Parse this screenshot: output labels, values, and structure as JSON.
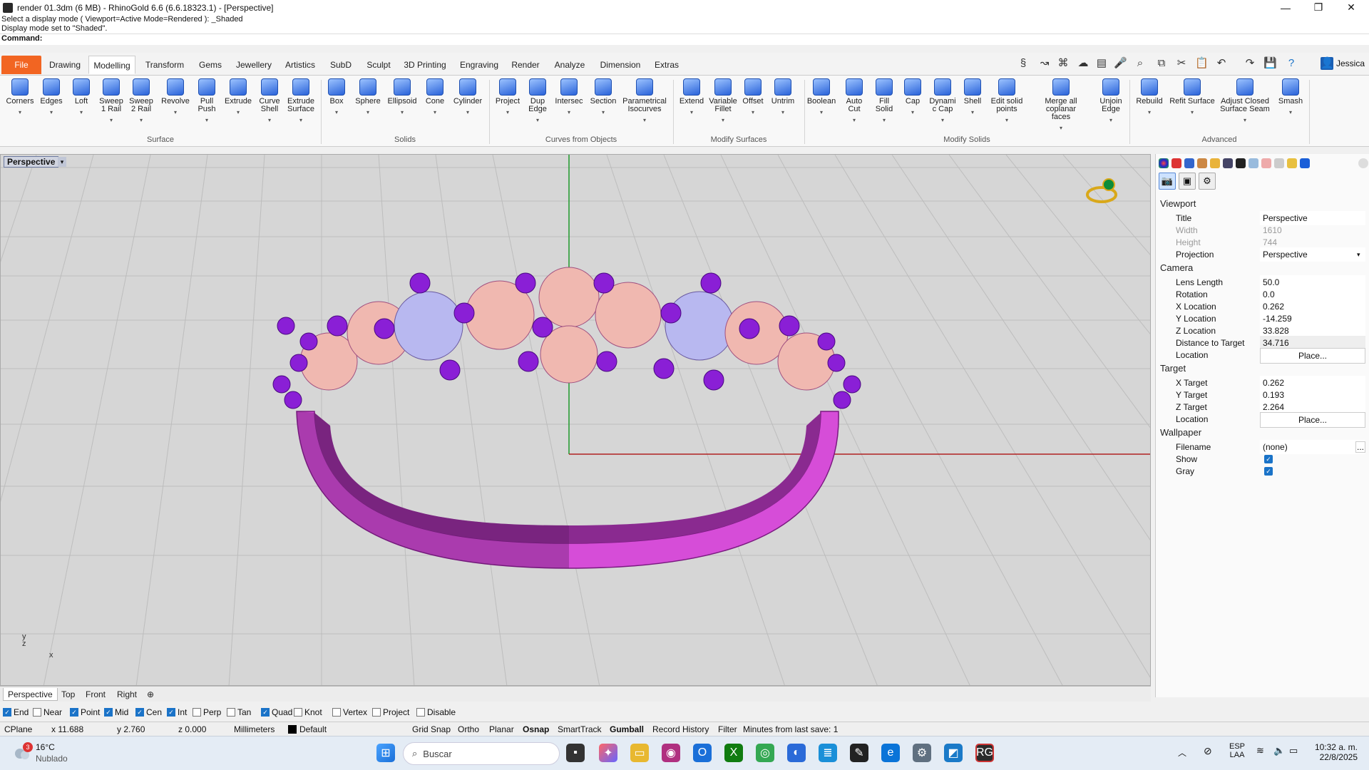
{
  "window": {
    "title": "render 01.3dm (6 MB) - RhinoGold 6.6 (6.6.18323.1) - [Perspective]",
    "minimize": "—",
    "maximize": "❐",
    "close": "✕"
  },
  "command": {
    "history_1": "Select a display mode ( Viewport=Active  Mode=Rendered ): _Shaded",
    "history_2": "Display mode set to \"Shaded\".",
    "label": "Command:",
    "value": ""
  },
  "tabs": [
    "File",
    "Drawing",
    "Modelling",
    "Transform",
    "Gems",
    "Jewellery",
    "Artistics",
    "SubD",
    "Sculpt",
    "3D Printing",
    "Engraving",
    "Render",
    "Analyze",
    "Dimension",
    "Extras"
  ],
  "user": "Jessica",
  "ribbon": {
    "buttons": [
      {
        "label": "Corners"
      },
      {
        "label": "Edges"
      },
      {
        "label": "Loft"
      },
      {
        "label": "Sweep\n1 Rail"
      },
      {
        "label": "Sweep\n2 Rail"
      },
      {
        "label": "Revolve"
      },
      {
        "label": "Pull\nPush"
      },
      {
        "label": "Extrude"
      },
      {
        "label": "Curve\nShell"
      },
      {
        "label": "Extrude\nSurface"
      },
      {
        "label": "Box"
      },
      {
        "label": "Sphere"
      },
      {
        "label": "Ellipsoid"
      },
      {
        "label": "Cone"
      },
      {
        "label": "Cylinder"
      },
      {
        "label": "Project"
      },
      {
        "label": "Dup\nEdge"
      },
      {
        "label": "Intersec"
      },
      {
        "label": "Section"
      },
      {
        "label": "Parametrical\nIsocurves"
      },
      {
        "label": "Extend"
      },
      {
        "label": "Variable\nFillet"
      },
      {
        "label": "Offset"
      },
      {
        "label": "Untrim"
      },
      {
        "label": "Boolean"
      },
      {
        "label": "Auto\nCut"
      },
      {
        "label": "Fill\nSolid"
      },
      {
        "label": "Cap"
      },
      {
        "label": "Dynami\nc Cap"
      },
      {
        "label": "Shell"
      },
      {
        "label": "Edit solid\npoints"
      },
      {
        "label": "Merge all coplanar\nfaces"
      },
      {
        "label": "Unjoin\nEdge"
      },
      {
        "label": "Rebuild"
      },
      {
        "label": "Refit Surface"
      },
      {
        "label": "Adjust Closed\nSurface Seam"
      },
      {
        "label": "Smash"
      }
    ],
    "groups": [
      "Surface",
      "Solids",
      "Curves from Objects",
      "Modify Surfaces",
      "Modify Solids",
      "Advanced"
    ]
  },
  "viewport": {
    "title": "Perspective",
    "axis_y": "y",
    "axis_z": "z",
    "axis_x": "x"
  },
  "view_tabs": [
    "Perspective",
    "Top",
    "Front",
    "Right",
    "⊕"
  ],
  "osnaps": [
    {
      "label": "End",
      "on": true
    },
    {
      "label": "Near",
      "on": false
    },
    {
      "label": "Point",
      "on": true
    },
    {
      "label": "Mid",
      "on": true
    },
    {
      "label": "Cen",
      "on": true
    },
    {
      "label": "Int",
      "on": true
    },
    {
      "label": "Perp",
      "on": false
    },
    {
      "label": "Tan",
      "on": false
    },
    {
      "label": "Quad",
      "on": true
    },
    {
      "label": "Knot",
      "on": false
    },
    {
      "label": "Vertex",
      "on": false
    },
    {
      "label": "Project",
      "on": false
    },
    {
      "label": "Disable",
      "on": false
    }
  ],
  "status": {
    "cplane": "CPlane",
    "x": "x 11.688",
    "y": "y 2.760",
    "z": "z 0.000",
    "units": "Millimeters",
    "layer": "Default",
    "grid_snap": "Grid Snap",
    "ortho": "Ortho",
    "planar": "Planar",
    "osnap": "Osnap",
    "smarttrack": "SmartTrack",
    "gumball": "Gumball",
    "record_history": "Record History",
    "filter": "Filter",
    "last_save": "Minutes from last save: 1"
  },
  "panel": {
    "viewport_section": "Viewport",
    "title_label": "Title",
    "title_value": "Perspective",
    "width_label": "Width",
    "width_value": "1610",
    "height_label": "Height",
    "height_value": "744",
    "projection_label": "Projection",
    "projection_value": "Perspective",
    "camera_section": "Camera",
    "lens_label": "Lens Length",
    "lens_value": "50.0",
    "rotation_label": "Rotation",
    "rotation_value": "0.0",
    "xloc_label": "X Location",
    "xloc_value": "0.262",
    "yloc_label": "Y Location",
    "yloc_value": "-14.259",
    "zloc_label": "Z Location",
    "zloc_value": "33.828",
    "dist_label": "Distance to Target",
    "dist_value": "34.716",
    "location_label": "Location",
    "place_button": "Place...",
    "target_section": "Target",
    "xt_label": "X Target",
    "xt_value": "0.262",
    "yt_label": "Y Target",
    "yt_value": "0.193",
    "zt_label": "Z Target",
    "zt_value": "2.264",
    "tloc_label": "Location",
    "tplace_button": "Place...",
    "wallpaper_section": "Wallpaper",
    "filename_label": "Filename",
    "filename_value": "(none)",
    "browse": "...",
    "show_label": "Show",
    "gray_label": "Gray"
  },
  "taskbar": {
    "weather_temp": "16°C",
    "weather_desc": "Nublado",
    "badge": "3",
    "search": "Buscar",
    "lang1": "ESP",
    "lang2": "LAA",
    "time": "10:32 a. m.",
    "date": "22/8/2025"
  },
  "colors": {
    "accent": "#f26522",
    "model": "#d64dd8",
    "prong": "#8a1fd6"
  }
}
